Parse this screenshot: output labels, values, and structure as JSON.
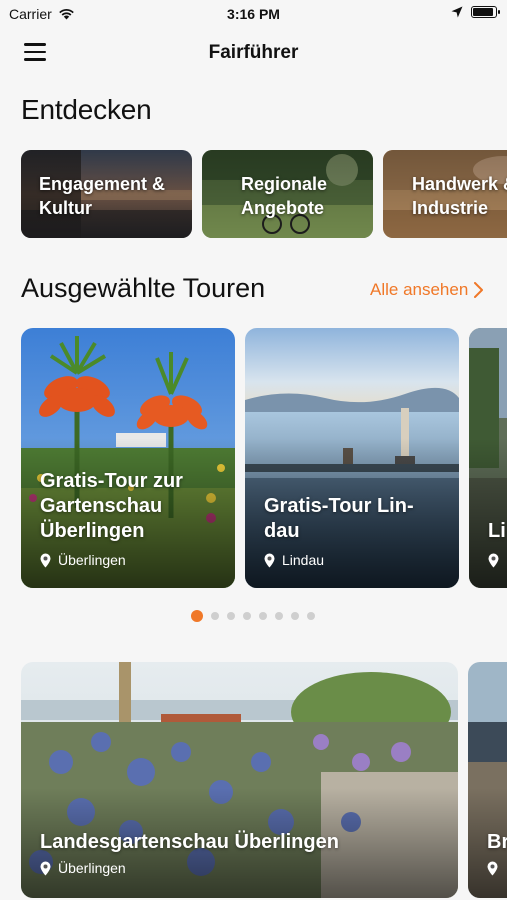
{
  "status_bar": {
    "carrier": "Carrier",
    "time": "3:16 PM"
  },
  "nav": {
    "title": "Fairführer"
  },
  "discover": {
    "heading": "Entdecken",
    "categories": [
      {
        "label": "Engagement &\nKultur"
      },
      {
        "label": "Regionale\nAngebote"
      },
      {
        "label": "Handwerk &\nIndustrie"
      }
    ]
  },
  "featured": {
    "heading": "Ausgewählte Touren",
    "see_all": "Alle ansehen",
    "tours": [
      {
        "title": "Gratis-Tour zur\nGartenschau\nÜberlingen",
        "location": "Überlingen"
      },
      {
        "title": "Gratis-Tour Lin-\ndau",
        "location": "Lindau"
      },
      {
        "title": "Li",
        "location": ""
      }
    ],
    "page_count": 8,
    "active_page": 1
  },
  "highlights": [
    {
      "title": "Landesgartenschau Überlingen",
      "location": "Überlingen"
    },
    {
      "title": "Br",
      "location": ""
    }
  ],
  "colors": {
    "accent": "#f07828"
  }
}
